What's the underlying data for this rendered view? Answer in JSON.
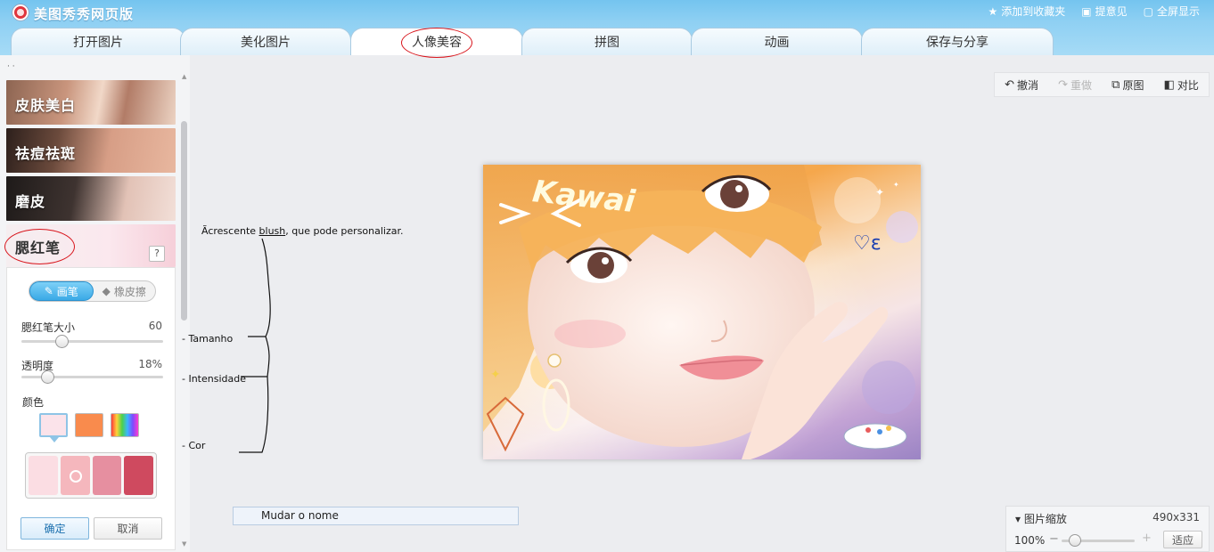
{
  "app": {
    "title": "美图秀秀网页版"
  },
  "top_links": [
    {
      "label": "添加到收藏夹",
      "icon": "star-icon"
    },
    {
      "label": "提意见",
      "icon": "chat-icon"
    },
    {
      "label": "全屏显示",
      "icon": "fullscreen-icon"
    }
  ],
  "tabs": [
    {
      "label": "打开图片"
    },
    {
      "label": "美化图片"
    },
    {
      "label": "人像美容",
      "active": true
    },
    {
      "label": "拼图"
    },
    {
      "label": "动画"
    },
    {
      "label": "保存与分享"
    }
  ],
  "left_panel": {
    "features": [
      {
        "label": "皮肤美白"
      },
      {
        "label": "祛痘祛斑"
      },
      {
        "label": "磨皮"
      },
      {
        "label": "腮红笔",
        "active": true
      }
    ],
    "help_label": "?",
    "blush": {
      "mode_brush": "画笔",
      "mode_eraser": "橡皮擦",
      "size_label": "腮红笔大小",
      "size_value": "60",
      "size_level": 0.28,
      "opacity_label": "透明度",
      "opacity_value": "18%",
      "opacity_level": 0.18,
      "color_label": "颜色",
      "color_presets": [
        "#fbe3ea",
        "#f98b4d",
        "rainbow"
      ],
      "palette": [
        "#fbdde3",
        "#f5b7bd",
        "#e68fa0",
        "#cf4a5f"
      ],
      "confirm": "确定",
      "cancel": "取消"
    }
  },
  "annotations": {
    "main_prefix": "Ãcrescente ",
    "main_underlined": "blush",
    "main_suffix": ", que pode personalizar.",
    "size": "- Tamanho",
    "intensity": "- Intensidade",
    "color": "- Cor"
  },
  "toolbar": {
    "undo": "撤消",
    "redo": "重做",
    "original": "原图",
    "compare": "对比"
  },
  "photo": {
    "overlay_text": "Kawai",
    "accent_colors": [
      "#f5a74c",
      "#c3a3d5",
      "#ffffff"
    ]
  },
  "rename": {
    "label": "Mudar o nome"
  },
  "zoom": {
    "title": "图片缩放",
    "dimensions": "490x331",
    "percent": "100%",
    "level": 0.18,
    "fit": "适应"
  }
}
